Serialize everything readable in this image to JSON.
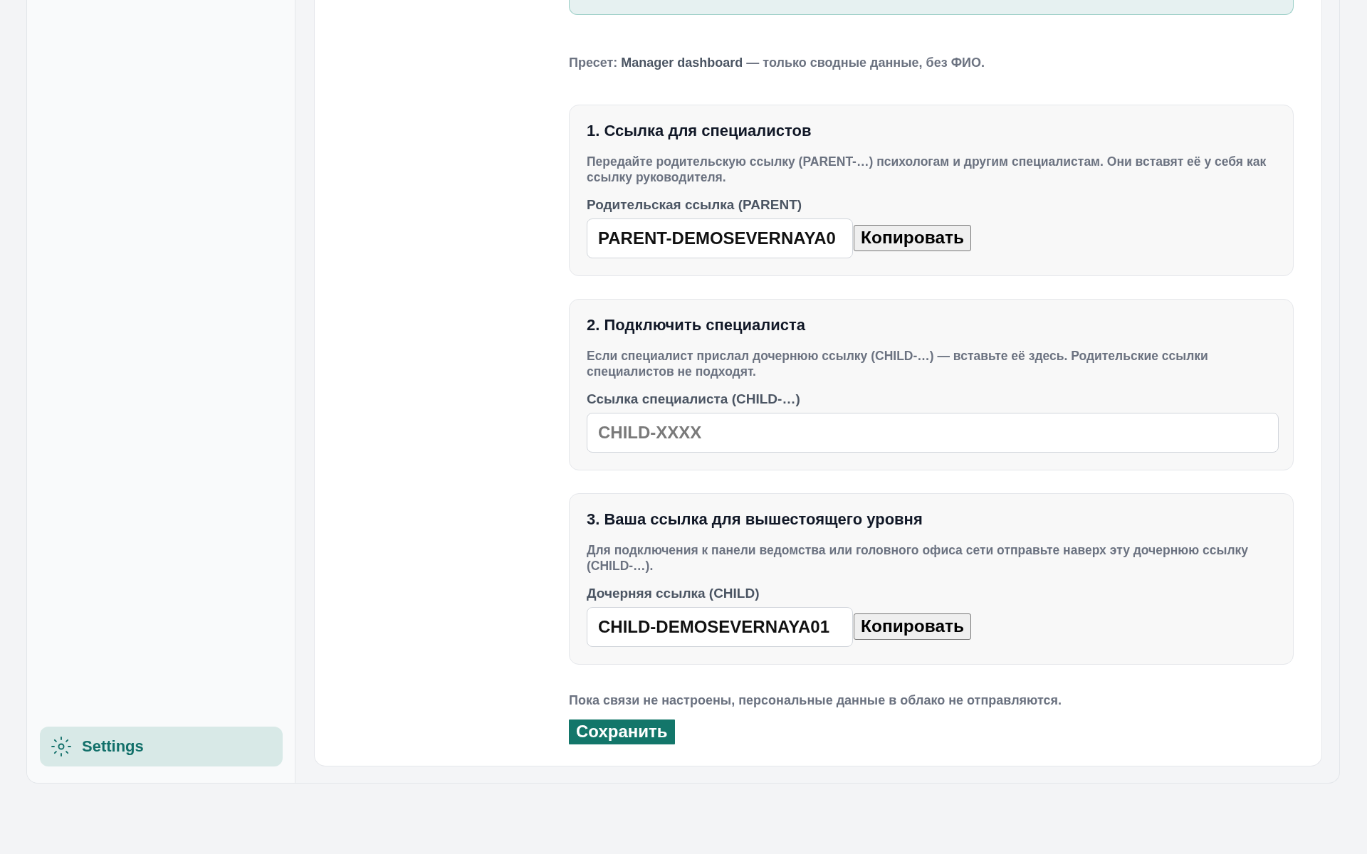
{
  "sidebar": {
    "items": [
      {
        "label": "Settings",
        "selected": true
      }
    ]
  },
  "preset_note": "Пресет: **Manager dashboard** — только сводные данные, без ФИО.",
  "sections": [
    {
      "title": "1. Ссылка для специалистов",
      "description": "Передайте родительскую ссылку (PARENT-…) психологам и другим специалистам. Они вставят её у себя как ссылку руководителя.",
      "field_label": "Родительская ссылка (PARENT)",
      "field": {
        "value": "PARENT-DEMOSEVERNAYA0"
      },
      "copy_button": "Копировать"
    },
    {
      "title": "2. Подключить специалиста",
      "description": "Если специалист прислал дочернюю ссылку (CHILD-…) — вставьте её здесь. Родительские ссылки специалистов не подходят.",
      "field_label": "Ссылка специалиста (CHILD-…)",
      "field": {
        "placeholder": "CHILD-XXXX"
      }
    },
    {
      "title": "3. Ваша ссылка для вышестоящего уровня",
      "description": "Для подключения к панели ведомства или головного офиса сети отправьте наверх эту дочернюю ссылку (CHILD-…).",
      "field_label": "Дочерняя ссылка (CHILD)",
      "field": {
        "value": "CHILD-DEMOSEVERNAYA01"
      },
      "copy_button": "Копировать"
    }
  ],
  "footer_note": "Пока связи не настроены, персональные данные в облако не отправляются.",
  "save_button": "Сохранить"
}
